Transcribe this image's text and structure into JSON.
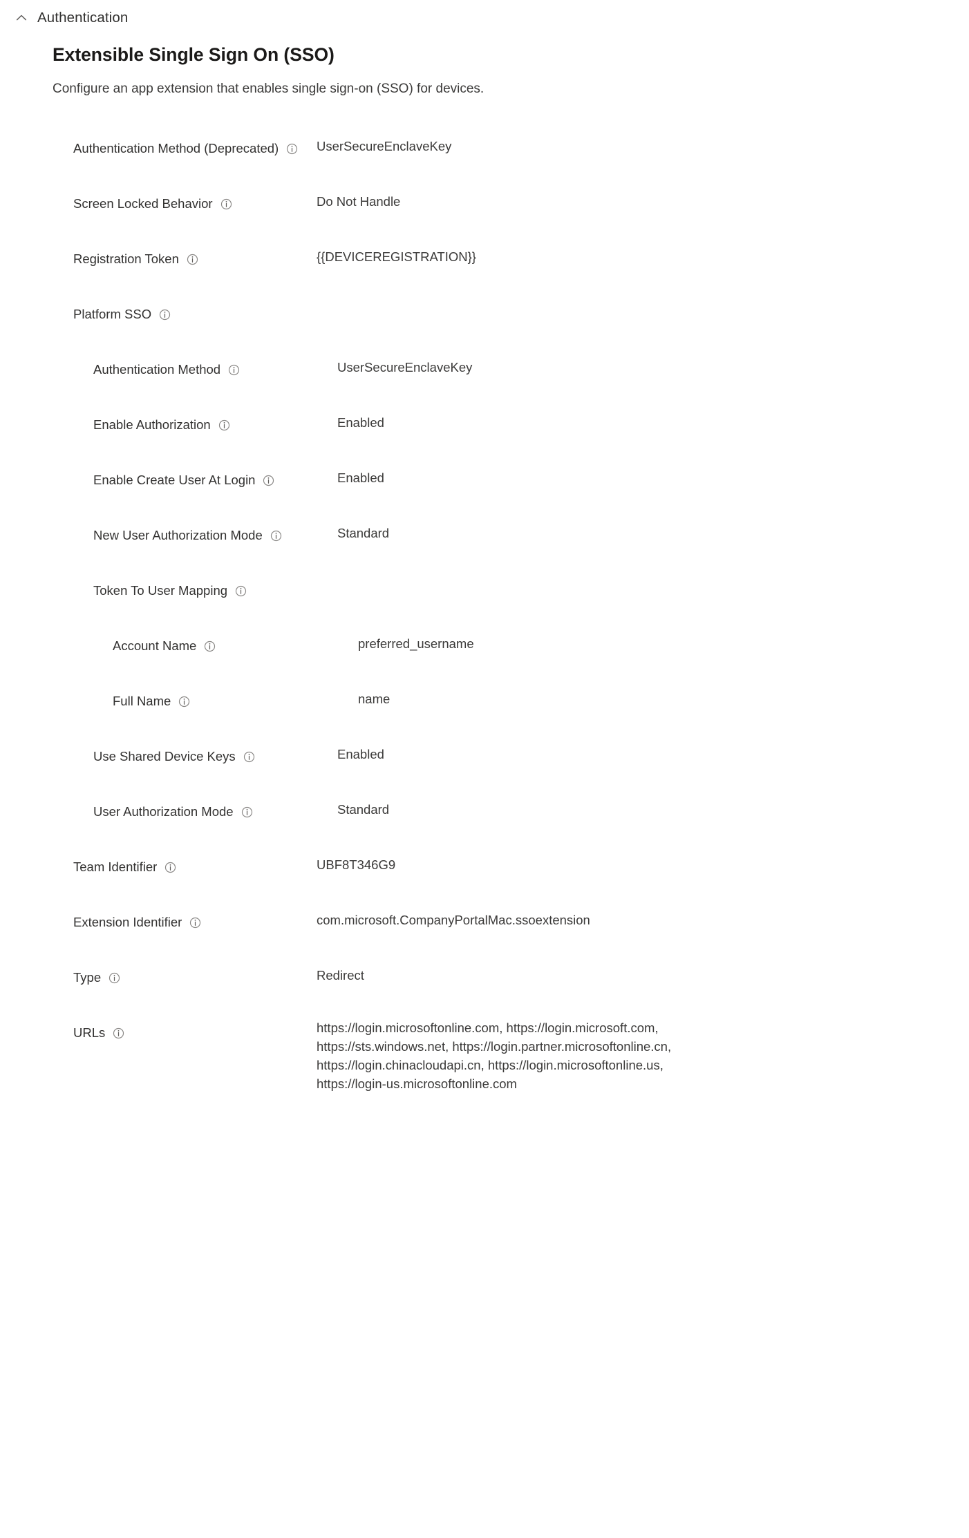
{
  "section": {
    "title": "Authentication",
    "collapse_icon": "chevron-up-icon",
    "expanded": true
  },
  "page": {
    "title": "Extensible Single Sign On (SSO)",
    "subtitle": "Configure an app extension that enables single sign-on (SSO) for devices."
  },
  "colors": {
    "text_primary": "#323130",
    "text_secondary": "#3b3a39",
    "title": "#1b1a19",
    "icon_stroke": "#605e5c",
    "background": "#ffffff"
  },
  "settings": [
    {
      "label": "Authentication Method (Deprecated)",
      "value": "UserSecureEnclaveKey",
      "indent": 0,
      "info_icon": "info-icon"
    },
    {
      "label": "Screen Locked Behavior",
      "value": "Do Not Handle",
      "indent": 0,
      "info_icon": "info-icon"
    },
    {
      "label": "Registration Token",
      "value": "{{DEVICEREGISTRATION}}",
      "indent": 0,
      "info_icon": "info-icon"
    },
    {
      "label": "Platform SSO",
      "value": "",
      "indent": 0,
      "info_icon": "info-icon"
    },
    {
      "label": "Authentication Method",
      "value": "UserSecureEnclaveKey",
      "indent": 1,
      "info_icon": "info-icon"
    },
    {
      "label": "Enable Authorization",
      "value": "Enabled",
      "indent": 1,
      "info_icon": "info-icon"
    },
    {
      "label": "Enable Create User At Login",
      "value": "Enabled",
      "indent": 1,
      "info_icon": "info-icon"
    },
    {
      "label": "New User Authorization Mode",
      "value": "Standard",
      "indent": 1,
      "info_icon": "info-icon"
    },
    {
      "label": "Token To User Mapping",
      "value": "",
      "indent": 1,
      "info_icon": "info-icon"
    },
    {
      "label": "Account Name",
      "value": "preferred_username",
      "indent": 2,
      "info_icon": "info-icon"
    },
    {
      "label": "Full Name",
      "value": "name",
      "indent": 2,
      "info_icon": "info-icon"
    },
    {
      "label": "Use Shared Device Keys",
      "value": "Enabled",
      "indent": 1,
      "info_icon": "info-icon"
    },
    {
      "label": "User Authorization Mode",
      "value": "Standard",
      "indent": 1,
      "info_icon": "info-icon"
    },
    {
      "label": "Team Identifier",
      "value": "UBF8T346G9",
      "indent": 0,
      "info_icon": "info-icon"
    },
    {
      "label": "Extension Identifier",
      "value": "com.microsoft.CompanyPortalMac.ssoextension",
      "indent": 0,
      "info_icon": "info-icon"
    },
    {
      "label": "Type",
      "value": "Redirect",
      "indent": 0,
      "info_icon": "info-icon"
    },
    {
      "label": "URLs",
      "value": "https://login.microsoftonline.com, https://login.microsoft.com,\nhttps://sts.windows.net, https://login.partner.microsoftonline.cn,\nhttps://login.chinacloudapi.cn, https://login.microsoftonline.us,\nhttps://login-us.microsoftonline.com",
      "indent": 0,
      "info_icon": "info-icon"
    }
  ]
}
